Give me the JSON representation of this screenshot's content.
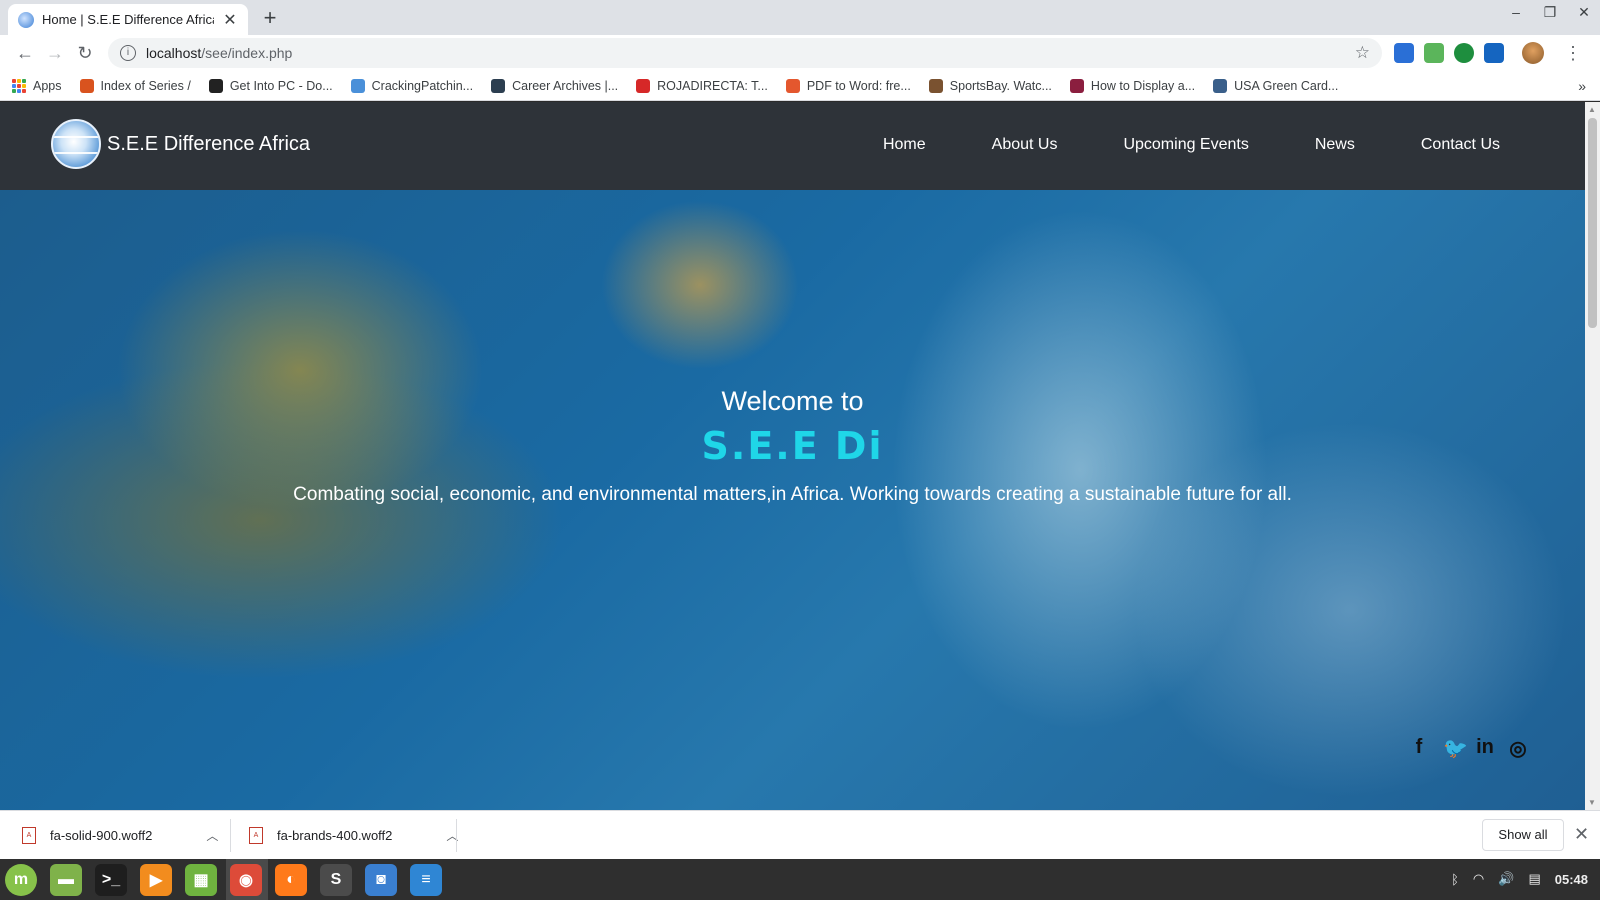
{
  "browser": {
    "tab_title": "Home | S.E.E Difference Africa",
    "url_host": "localhost",
    "url_path": "/see/index.php",
    "bookmarks": [
      {
        "label": "Apps",
        "icon": "apps-grid-icon",
        "color": "#4285f4"
      },
      {
        "label": "Index of Series /",
        "icon": "series-icon",
        "color": "#d9531e"
      },
      {
        "label": "Get Into PC - Do...",
        "icon": "getintopc-icon",
        "color": "#222222"
      },
      {
        "label": "CrackingPatchin...",
        "icon": "cracking-icon",
        "color": "#4a90d9"
      },
      {
        "label": "Career Archives |...",
        "icon": "career-icon",
        "color": "#2c3e50"
      },
      {
        "label": "ROJADIRECTA: T...",
        "icon": "rojadirecta-icon",
        "color": "#d62828"
      },
      {
        "label": "PDF to Word: fre...",
        "icon": "pdf-icon",
        "color": "#e4572e"
      },
      {
        "label": "SportsBay. Watc...",
        "icon": "sportsbay-icon",
        "color": "#7a5230"
      },
      {
        "label": "How to Display a...",
        "icon": "howto-icon",
        "color": "#8b1e3f"
      },
      {
        "label": "USA Green Card...",
        "icon": "greencard-icon",
        "color": "#3a5f8a"
      }
    ]
  },
  "site": {
    "brand": "S.E.E Difference Africa",
    "nav": [
      "Home",
      "About Us",
      "Upcoming Events",
      "News",
      "Contact Us"
    ],
    "hero": {
      "welcome": "Welcome to",
      "brand_typed": "S.E.E Di",
      "tagline": "Combating social, economic, and environmental matters,in Africa. Working towards creating a sustainable future for all."
    },
    "social": [
      {
        "name": "facebook-icon",
        "glyph": "f"
      },
      {
        "name": "twitter-icon",
        "glyph": "🐦"
      },
      {
        "name": "linkedin-icon",
        "glyph": "in"
      },
      {
        "name": "instagram-icon",
        "glyph": "◎"
      }
    ],
    "colors": {
      "nav_bg": "#2e3339",
      "accent": "#1fd6e8"
    }
  },
  "downloads": {
    "items": [
      "fa-solid-900.woff2",
      "fa-brands-400.woff2"
    ],
    "show_all": "Show all"
  },
  "taskbar": {
    "clock": "05:48",
    "apps": [
      {
        "name": "mint-menu-icon",
        "color": "#87c24a",
        "glyph": "m"
      },
      {
        "name": "files-icon",
        "color": "#7fb24a",
        "glyph": "▬"
      },
      {
        "name": "terminal-icon",
        "color": "#1e1e1e",
        "glyph": ">_"
      },
      {
        "name": "media-player-icon",
        "color": "#f28c1e",
        "glyph": "▶"
      },
      {
        "name": "calculator-icon",
        "color": "#6fb33f",
        "glyph": "▦"
      },
      {
        "name": "chrome-icon",
        "color": "#dd4b39",
        "glyph": "◉"
      },
      {
        "name": "firefox-icon",
        "color": "#ff7a1a",
        "glyph": "◐"
      },
      {
        "name": "sublime-icon",
        "color": "#4b4b4b",
        "glyph": "S"
      },
      {
        "name": "screenshot-icon",
        "color": "#3a7fd0",
        "glyph": "◙"
      },
      {
        "name": "text-editor-icon",
        "color": "#2f86d4",
        "glyph": "≡"
      }
    ]
  }
}
